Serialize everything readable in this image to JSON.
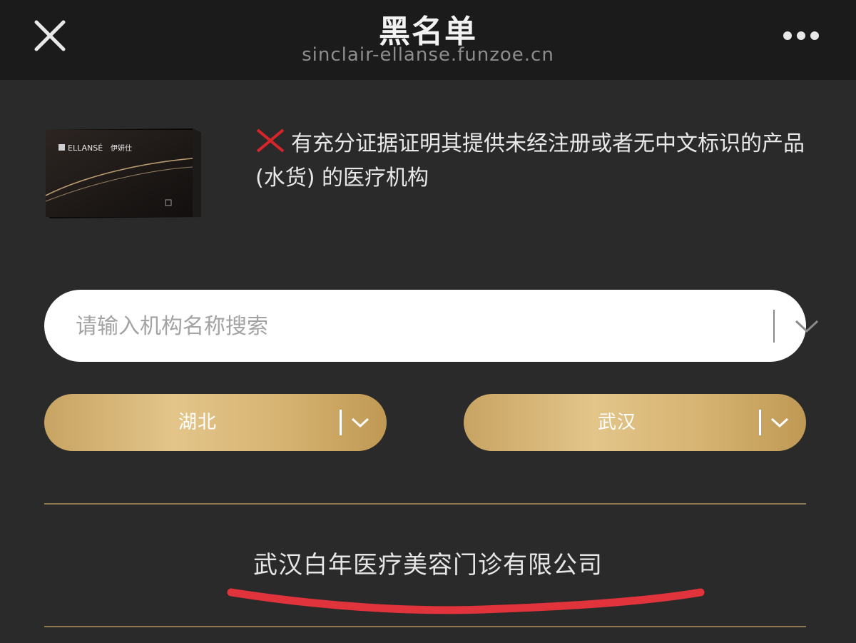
{
  "header": {
    "title": "黑名单",
    "url": "sinclair-ellanse.funzoe.cn"
  },
  "product": {
    "brand_en": "ELLANSÉ",
    "brand_cn": "伊妍仕"
  },
  "notice": {
    "text": "有充分证据证明其提供未经注册或者无中文标识的产品 (水货) 的医疗机构",
    "mark_color": "#d8252a"
  },
  "search": {
    "placeholder": "请输入机构名称搜索"
  },
  "filters": {
    "province": "湖北",
    "city": "武汉"
  },
  "results": [
    {
      "name": "武汉白年医疗美容门诊有限公司"
    }
  ],
  "colors": {
    "background": "#2a2a2a",
    "header": "#1b1b1b",
    "gold": "#d6b371",
    "annotation": "#e0333b"
  }
}
